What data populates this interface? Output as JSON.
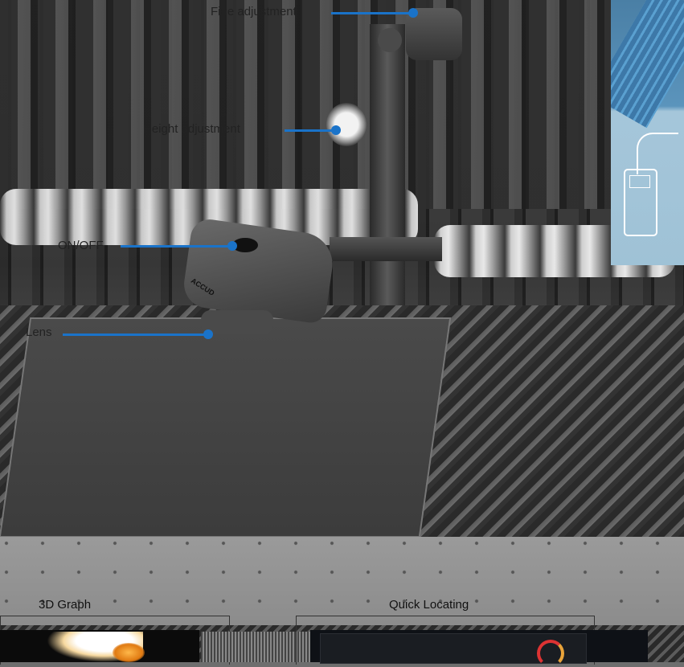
{
  "callouts": {
    "fine_adjustment": "Fine adjustment",
    "height_adjustment": "Height adjustment",
    "on_off": "ON/OFF",
    "lens": "Lens"
  },
  "device": {
    "brand": "ACCUD"
  },
  "bottom_panels": {
    "graph_3d": "3D Graph",
    "quick_locating": "Quick Locating"
  },
  "colors": {
    "accent": "#1a73c9",
    "side_panel": "#5b94bc"
  }
}
